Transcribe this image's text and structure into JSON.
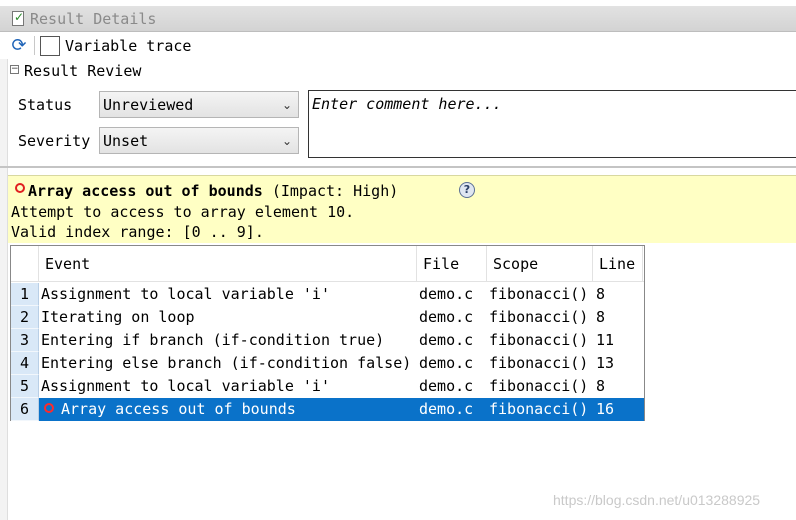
{
  "window": {
    "title": "Result Details"
  },
  "toolbar": {
    "refresh_icon": "refresh-icon",
    "variable_trace_label": "Variable trace",
    "variable_trace_checked": false
  },
  "review": {
    "section_label": "Result Review",
    "status_label": "Status",
    "status_value": "Unreviewed",
    "severity_label": "Severity",
    "severity_value": "Unset",
    "comment_placeholder": "Enter comment here..."
  },
  "finding": {
    "title": "Array access out of bounds",
    "impact": " (Impact: High)",
    "line1": "Attempt to access to array element 10.",
    "line2": "Valid index range: [0 .. 9].",
    "status_color": "#e02020"
  },
  "events": {
    "headers": {
      "event": "Event",
      "file": "File",
      "scope": "Scope",
      "line": "Line"
    },
    "rows": [
      {
        "num": "1",
        "event": "Assignment to local variable 'i'",
        "file": "demo.c",
        "scope": "fibonacci()",
        "line": "8"
      },
      {
        "num": "2",
        "event": "Iterating on loop",
        "file": "demo.c",
        "scope": "fibonacci()",
        "line": "8"
      },
      {
        "num": "3",
        "event": "Entering if branch (if-condition true)",
        "file": "demo.c",
        "scope": "fibonacci()",
        "line": "11"
      },
      {
        "num": "4",
        "event": "Entering else branch (if-condition false)",
        "file": "demo.c",
        "scope": "fibonacci()",
        "line": "13"
      },
      {
        "num": "5",
        "event": "Assignment to local variable 'i'",
        "file": "demo.c",
        "scope": "fibonacci()",
        "line": "8"
      },
      {
        "num": "6",
        "event": "Array access out of bounds",
        "file": "demo.c",
        "scope": "fibonacci()",
        "line": "16",
        "selected": true
      }
    ],
    "selection_color": "#0a72c9"
  },
  "watermark": "https://blog.csdn.net/u013288925"
}
